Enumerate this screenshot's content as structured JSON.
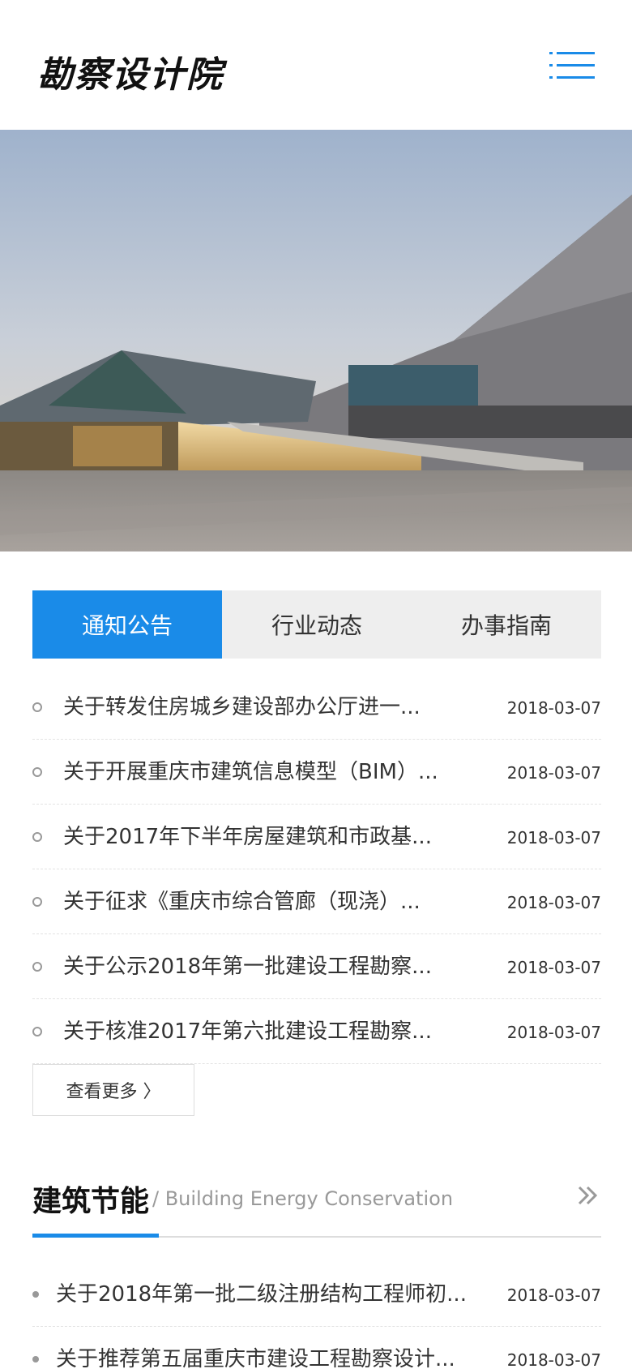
{
  "header": {
    "logo": "勘察设计院",
    "menu_icon": "hamburger-menu-icon",
    "accent_color": "#1a8be8"
  },
  "banner": {
    "image": "modern-building-photo"
  },
  "tabs": [
    {
      "label": "通知公告",
      "active": true
    },
    {
      "label": "行业动态",
      "active": false
    },
    {
      "label": "办事指南",
      "active": false
    }
  ],
  "news": [
    {
      "title": "关于转发住房城乡建设部办公厅进一...",
      "date": "2018-03-07"
    },
    {
      "title": "关于开展重庆市建筑信息模型（BIM）...",
      "date": "2018-03-07"
    },
    {
      "title": "关于2017年下半年房屋建筑和市政基...",
      "date": "2018-03-07"
    },
    {
      "title": "关于征求《重庆市综合管廊（现浇）...",
      "date": "2018-03-07"
    },
    {
      "title": "关于公示2018年第一批建设工程勘察...",
      "date": "2018-03-07"
    },
    {
      "title": "关于核准2017年第六批建设工程勘察...",
      "date": "2018-03-07"
    }
  ],
  "more_label": "查看更多 〉",
  "section": {
    "title": "建筑节能",
    "subtitle": "/ Building Energy Conservation",
    "more_icon": "double-chevron-right-icon",
    "items": [
      {
        "title": "关于2018年第一批二级注册结构工程师初...",
        "date": "2018-03-07"
      },
      {
        "title": "关于推荐第五届重庆市建设工程勘察设计...",
        "date": "2018-03-07"
      }
    ]
  }
}
